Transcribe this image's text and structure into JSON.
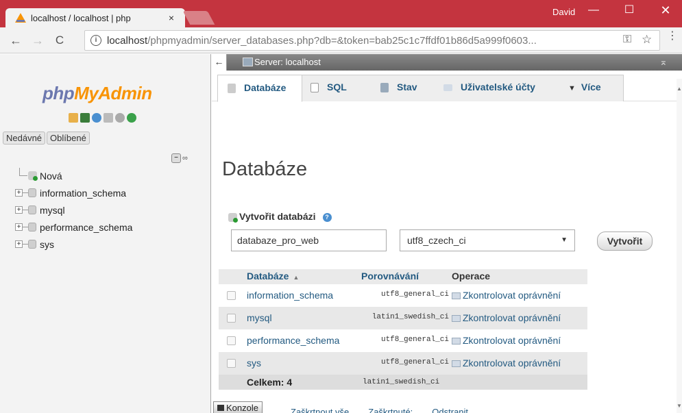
{
  "browser": {
    "tab_title": "localhost / localhost | php",
    "tab_close": "×",
    "user": "David",
    "minimize": "—",
    "maximize": "☐",
    "close": "✕",
    "back": "←",
    "forward": "→",
    "reload": "C",
    "info": "i",
    "url_host": "localhost",
    "url_path": "/phpmyadmin/server_databases.php?db=&token=bab25c1c7ffdf01b86d5a999f0603...",
    "key_icon": "⚿",
    "star_icon": "☆",
    "menu_icon": "⋮"
  },
  "sidebar": {
    "logo_left": "php",
    "logo_right": "MyAdmin",
    "recent": "Nedávné",
    "favorites": "Oblíbené",
    "collapse": "−",
    "link": "∞",
    "new_item": "Nová",
    "expander": "+",
    "databases": [
      "information_schema",
      "mysql",
      "performance_schema",
      "sys"
    ]
  },
  "server_bar": {
    "back_arrow": "←",
    "label": "Server: localhost",
    "scroll_top": "⌅"
  },
  "tabs": {
    "databases": "Databáze",
    "sql": "SQL",
    "status": "Stav",
    "users": "Uživatelské účty",
    "more_arrow": "▼",
    "more": "Více"
  },
  "main": {
    "title": "Databáze",
    "create_label": "Vytvořit databázi",
    "help": "?",
    "db_name_value": "databaze_pro_web",
    "collation_value": "utf8_czech_ci",
    "caret": "▼",
    "create_button": "Vytvořit"
  },
  "table": {
    "headers": {
      "database": "Databáze",
      "sort": "▲",
      "collation": "Porovnávání",
      "action": "Operace"
    },
    "rows": [
      {
        "name": "information_schema",
        "collation": "utf8_general_ci",
        "action": "Zkontrolovat oprávnění"
      },
      {
        "name": "mysql",
        "collation": "latin1_swedish_ci",
        "action": "Zkontrolovat oprávnění"
      },
      {
        "name": "performance_schema",
        "collation": "utf8_general_ci",
        "action": "Zkontrolovat oprávnění"
      },
      {
        "name": "sys",
        "collation": "utf8_general_ci",
        "action": "Zkontrolovat oprávnění"
      }
    ],
    "total_label": "Celkem: 4",
    "total_collation": "latin1_swedish_ci"
  },
  "console": {
    "label": "Konzole",
    "uncheck_all": "Zaškrtnout vše",
    "with_selected": "Zaškrtnuté:",
    "delete": "Odstranit"
  },
  "scrollbar": {
    "up": "▲",
    "down": "▼"
  },
  "colors": {
    "titlebar": "#c4343f",
    "link": "#235a81",
    "logo_blue": "#6c78af",
    "logo_orange": "#f89406"
  }
}
